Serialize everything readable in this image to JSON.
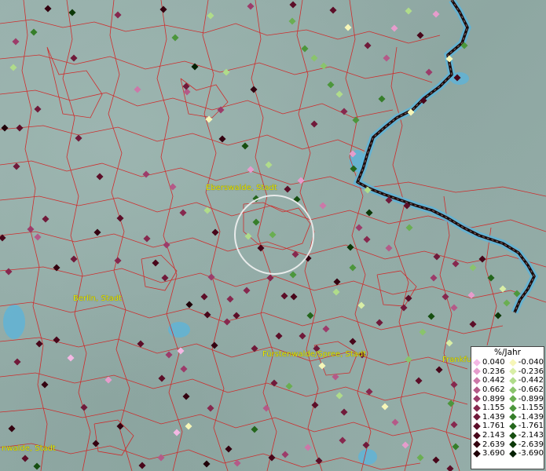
{
  "map": {
    "places": [
      {
        "id": "eberswalde",
        "label": "Eberswalde, Stadt"
      },
      {
        "id": "berlin",
        "label": "Berlin, Stadt"
      },
      {
        "id": "fuerstenwalde",
        "label": "Fürstenwalde/Spree, Stadt"
      },
      {
        "id": "frankfurt",
        "label": "Frankfu"
      },
      {
        "id": "ewalde",
        "label": "nwalde, Stadt"
      }
    ],
    "colors": {
      "boundary": "#d41f1f",
      "river_border": "#1a0a0a",
      "water": "#5ab4dc",
      "selection_circle": "#f2f2f2"
    }
  },
  "legend": {
    "title": "%/Jahr",
    "positive": [
      {
        "value": "0.040",
        "color": "#f4b8e4"
      },
      {
        "value": "0.236",
        "color": "#e69ccc"
      },
      {
        "value": "0.442",
        "color": "#cc78a8"
      },
      {
        "value": "0.662",
        "color": "#b45a88"
      },
      {
        "value": "0.899",
        "color": "#9c3c6a"
      },
      {
        "value": "1.155",
        "color": "#86284e"
      },
      {
        "value": "1.439",
        "color": "#701a3a"
      },
      {
        "value": "1.761",
        "color": "#5c0e28"
      },
      {
        "value": "2.143",
        "color": "#48061a"
      },
      {
        "value": "2.639",
        "color": "#340210"
      },
      {
        "value": "3.690",
        "color": "#200008"
      }
    ],
    "negative": [
      {
        "value": "-0.040",
        "color": "#f6f6b8"
      },
      {
        "value": "-0.236",
        "color": "#d8eea6"
      },
      {
        "value": "-0.442",
        "color": "#b0dc8a"
      },
      {
        "value": "-0.662",
        "color": "#8ac46c"
      },
      {
        "value": "-0.899",
        "color": "#6aae52"
      },
      {
        "value": "-1.155",
        "color": "#4c963c"
      },
      {
        "value": "-1.439",
        "color": "#367e2a"
      },
      {
        "value": "-1.761",
        "color": "#24661c"
      },
      {
        "value": "-2.143",
        "color": "#164e10"
      },
      {
        "value": "-2.639",
        "color": "#0c3808"
      },
      {
        "value": "-3.690",
        "color": "#042002"
      }
    ]
  }
}
